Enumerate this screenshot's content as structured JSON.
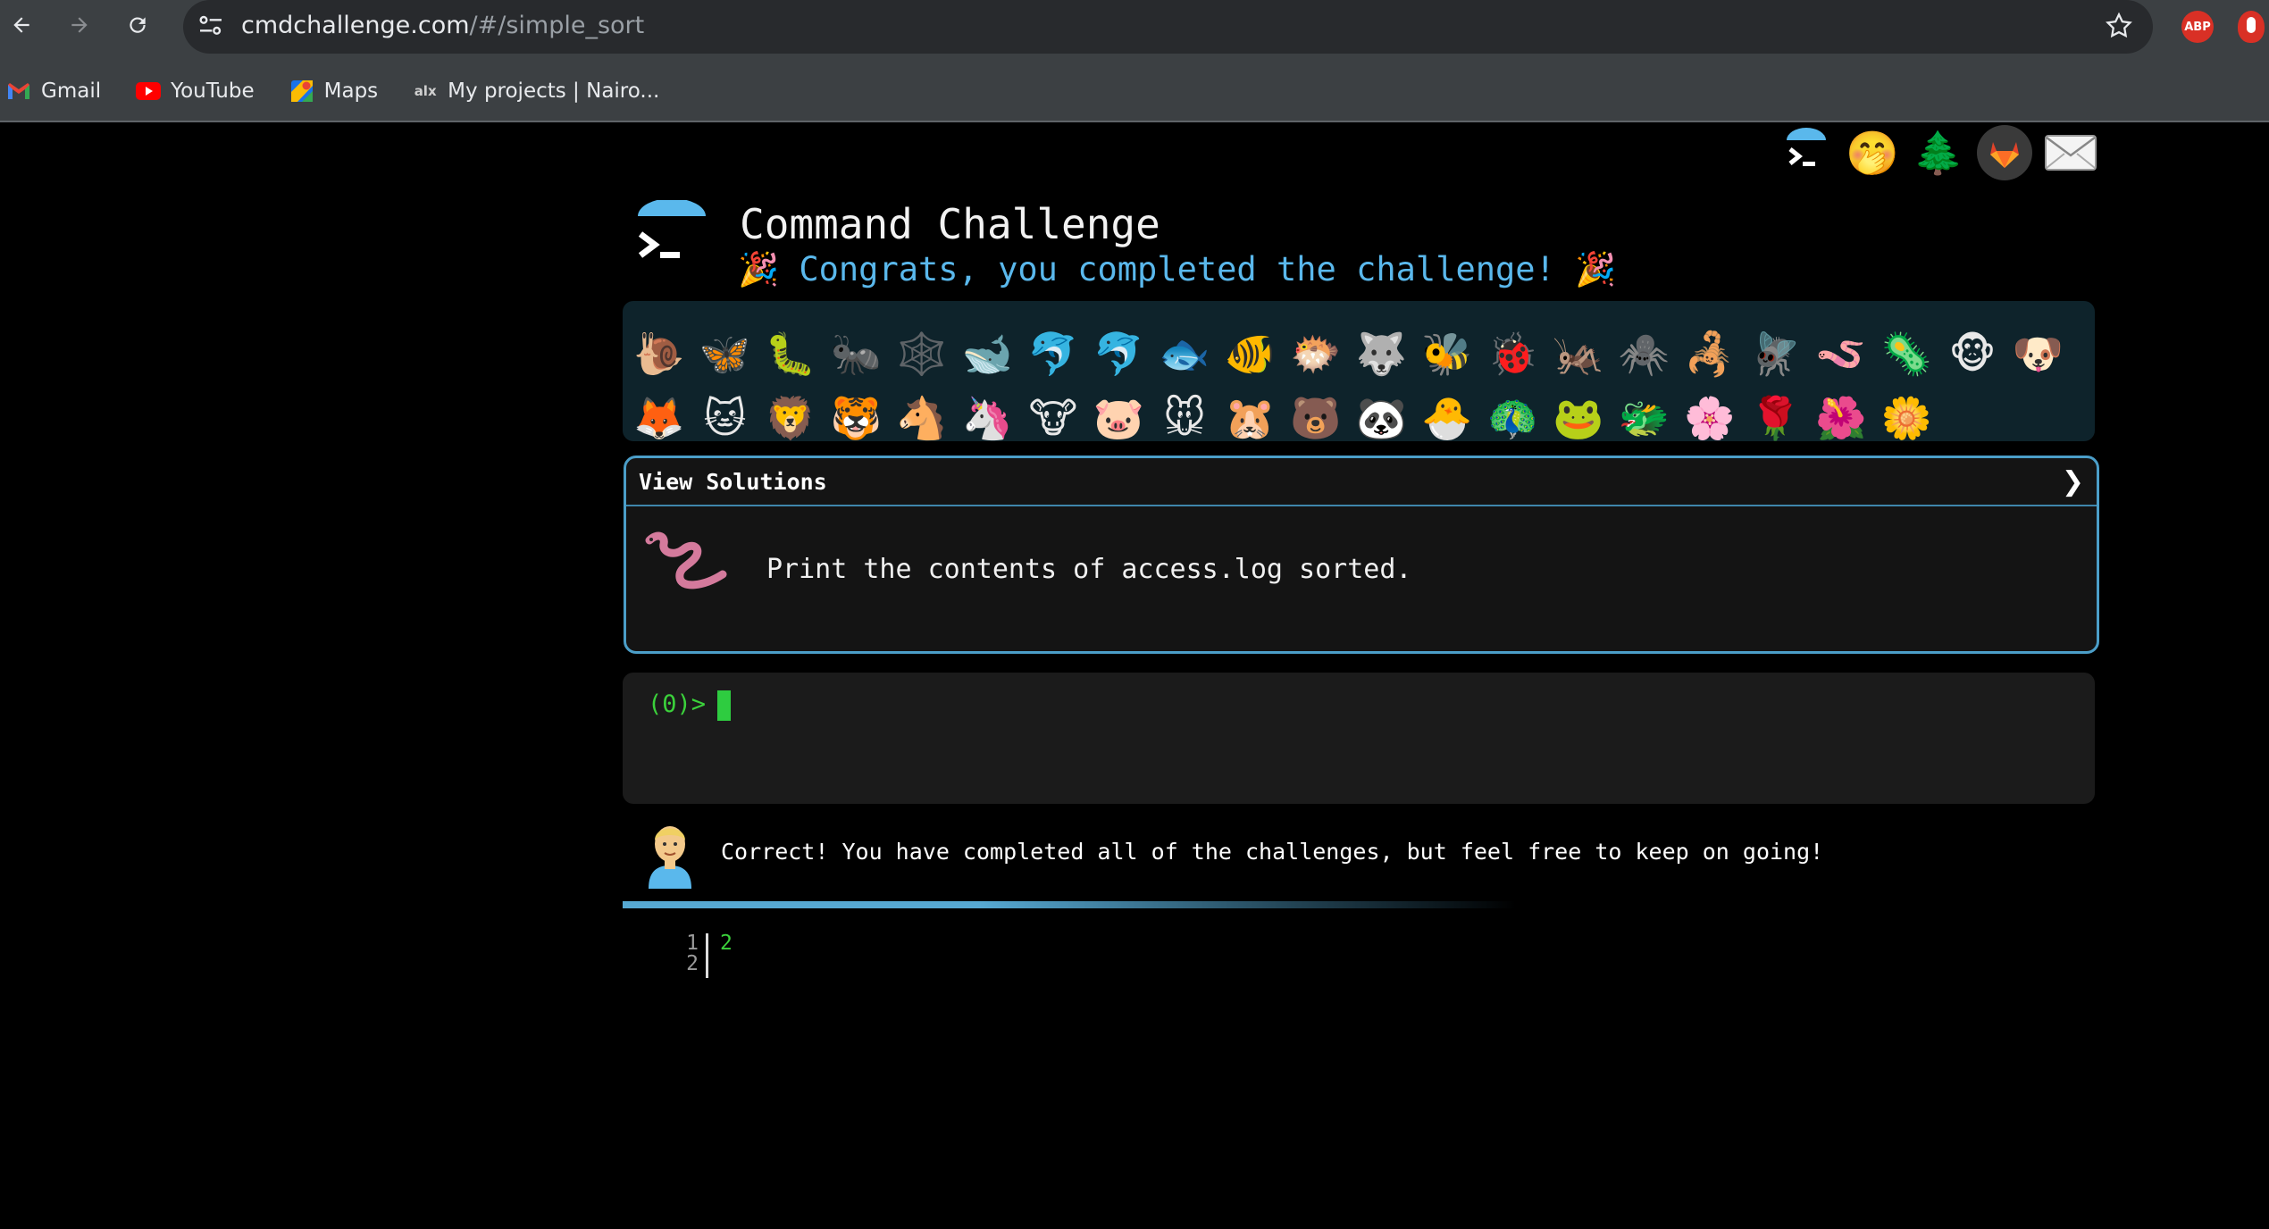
{
  "browser": {
    "url_host": "cmdchallenge.com",
    "url_path": "/#/simple_sort",
    "bookmarks": [
      {
        "label": "Gmail",
        "icon": "gmail-icon"
      },
      {
        "label": "YouTube",
        "icon": "youtube-icon"
      },
      {
        "label": "Maps",
        "icon": "maps-icon"
      },
      {
        "label": "My projects | Nairo...",
        "icon": "alx-icon"
      }
    ],
    "extension_badge": "ABP"
  },
  "header": {
    "title": "Command Challenge",
    "subtitle": "Congrats, you completed the challenge!",
    "subtitle_emoji": "🎉"
  },
  "top_icons": [
    "terminal-logo-icon",
    "face-with-hand-over-mouth-icon",
    "evergreen-tree-icon",
    "gitlab-icon",
    "envelope-icon"
  ],
  "emoji_tray": {
    "row1": [
      "🐌",
      "🦋",
      "🐛",
      "🐜",
      "🕸️",
      "🐋",
      "🐬",
      "🐬",
      "🐟",
      "🐠",
      "🐡",
      "🐺",
      "🐝",
      "🐞",
      "🦗",
      "🕷️",
      "🦂",
      "🪰",
      "🪱",
      "🦠",
      "🐵",
      "🐶"
    ],
    "row2": [
      "🦊",
      "🐱",
      "🦁",
      "🐯",
      "🐴",
      "🦄",
      "🐮",
      "🐷",
      "🐭",
      "🐹",
      "🐻",
      "🐼",
      "🐣",
      "🦚",
      "🐸",
      "🐲",
      "🌸",
      "🌹",
      "🌺",
      "🌼"
    ]
  },
  "challenge": {
    "view_solutions_label": "View Solutions",
    "chevron": "❯",
    "description": "Print the contents of access.log sorted."
  },
  "terminal": {
    "prompt": "(0)>"
  },
  "response": {
    "message": "Correct! You have completed all of the challenges, but feel free to keep on going!"
  },
  "output": {
    "line_numbers": [
      "1",
      "2"
    ],
    "value": "2"
  },
  "colors": {
    "accent_blue": "#5ab8ec",
    "terminal_green": "#3bd13b",
    "border_blue": "#4b9ec8"
  }
}
